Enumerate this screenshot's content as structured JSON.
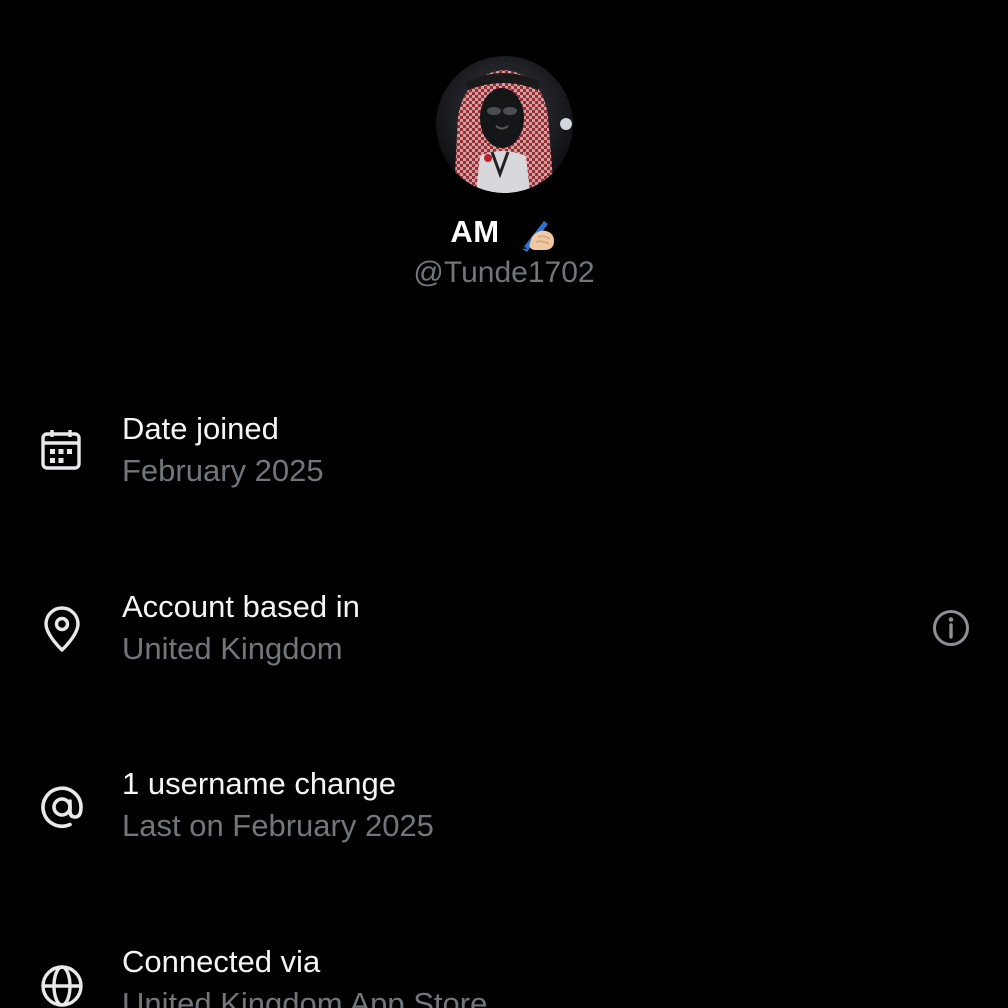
{
  "profile": {
    "display_name": "AM",
    "name_emoji": "writing-hand-emoji",
    "handle": "@Tunde1702",
    "avatar": "profile-photo"
  },
  "details": [
    {
      "icon": "calendar-icon",
      "title": "Date joined",
      "subtitle": "February 2025"
    },
    {
      "icon": "location-pin-icon",
      "title": "Account based in",
      "subtitle": "United Kingdom",
      "action_icon": "info-icon"
    },
    {
      "icon": "at-sign-icon",
      "title": "1 username change",
      "subtitle": "Last on February 2025"
    },
    {
      "icon": "globe-icon",
      "title": "Connected via",
      "subtitle": "United Kingdom App Store"
    }
  ],
  "colors": {
    "background": "#000000",
    "primary_text": "#e7e9ea",
    "secondary_text": "#71767b"
  }
}
